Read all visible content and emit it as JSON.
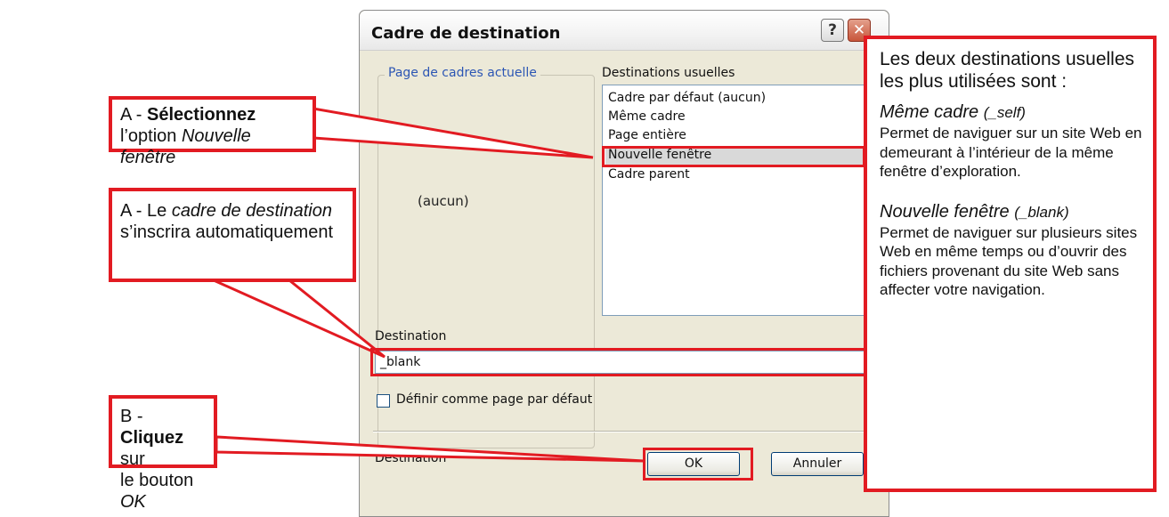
{
  "dialog": {
    "title": "Cadre de destination",
    "help_glyph": "?",
    "close_glyph": "✕",
    "group_label": "Page de cadres actuelle",
    "group_value": "(aucun)",
    "list_label": "Destinations usuelles",
    "list_items": [
      "Cadre par défaut (aucun)",
      "Même cadre",
      "Page entière",
      "Nouvelle fenêtre",
      "Cadre parent"
    ],
    "selected_item": "Nouvelle fenêtre",
    "destination_label": "Destination",
    "destination_value": "_blank",
    "checkbox_label": "Définir comme page par défaut",
    "checkbox_checked": false,
    "ok_label": "OK",
    "cancel_label": "Annuler"
  },
  "callouts": {
    "a1": {
      "prefix": "A - ",
      "bold": "Sélectionnez",
      "line2_pre": "l’option ",
      "line2_italic": "Nouvelle fenêtre"
    },
    "a2": {
      "prefix": "A - Le ",
      "italic": "cadre de destination",
      "line2": "s’inscrira automatiquement"
    },
    "b": {
      "prefix": "B - ",
      "bold": "Cliquez",
      "suffix": " sur",
      "line2_pre": "le bouton ",
      "line2_italic": "OK"
    }
  },
  "info": {
    "intro": "Les deux destinations usuelles les plus utilisées sont :",
    "s1_title": "Même cadre ",
    "s1_code": "(_self)",
    "s1_body": "Permet de naviguer sur un site Web en demeurant à l’intérieur de la même fenêtre d’exploration.",
    "s2_title": "Nouvelle fenêtre ",
    "s2_code": "(_blank)",
    "s2_body": "Permet de naviguer sur plusieurs sites Web en même temps ou d’ouvrir des fichiers provenant du site Web sans affecter votre navigation."
  },
  "colors": {
    "annotation_red": "#e21b22",
    "dialog_bg": "#ECE9D8",
    "group_label_blue": "#2c56b4"
  }
}
